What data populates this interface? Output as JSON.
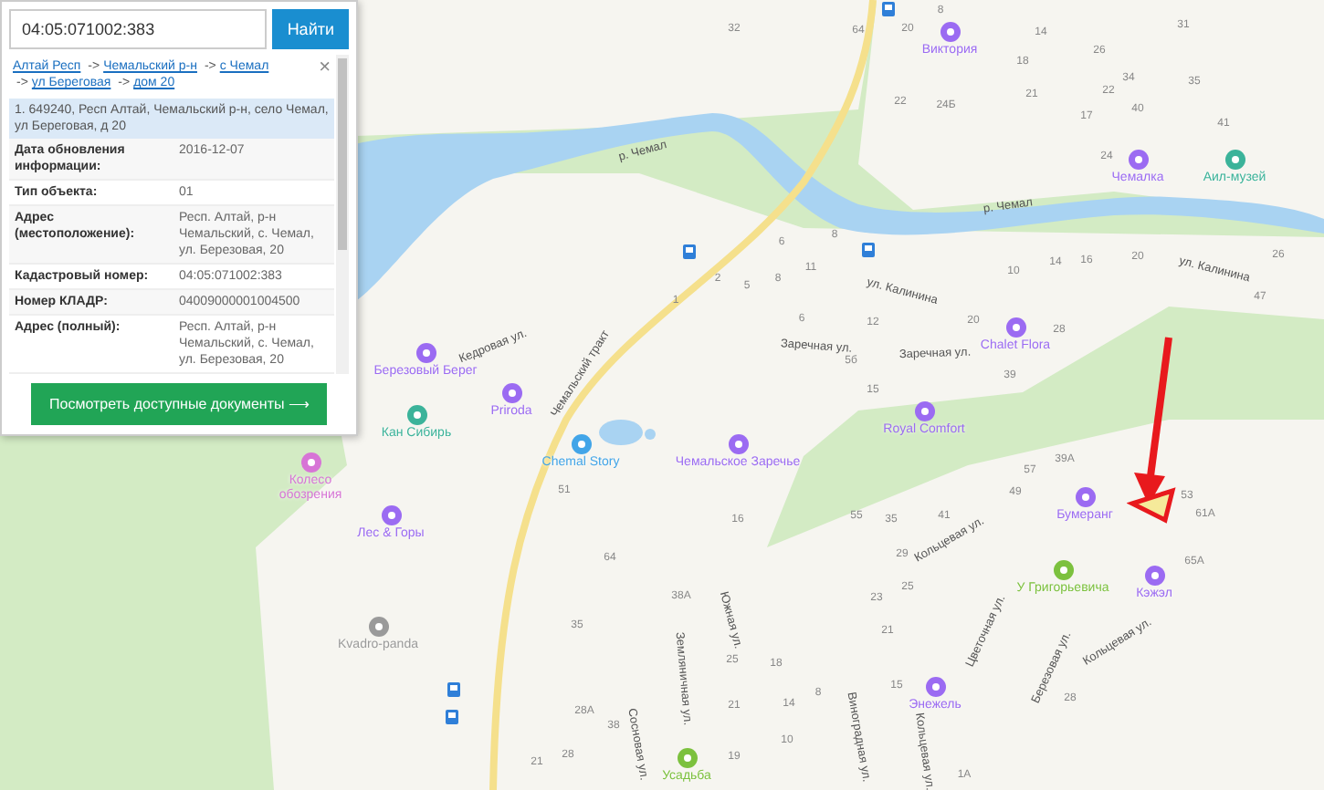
{
  "search": {
    "value": "04:05:071002:383",
    "button": "Найти"
  },
  "panel": {
    "breadcrumb": [
      "Алтай Респ",
      "Чемальский р-н",
      "с Чемал",
      "ул Береговая",
      "дом 20"
    ],
    "separator": "->",
    "close": "×",
    "result": "1. 649240, Респ Алтай, Чемальский р-н, село Чемал, ул Береговая, д 20",
    "rows": [
      {
        "label": "Дата обновления информации:",
        "value": "2016-12-07"
      },
      {
        "label": "Тип объекта:",
        "value": "01"
      },
      {
        "label": "Адрес (местоположение):",
        "value": "Респ. Алтай, р-н Чемальский, с. Чемал, ул. Березовая, 20"
      },
      {
        "label": "Кадастровый номер:",
        "value": "04:05:071002:383"
      },
      {
        "label": "Номер КЛАДР:",
        "value": "04009000001004500"
      },
      {
        "label": "Адрес (полный):",
        "value": "Респ. Алтай, р-н Чемальский, с. Чемал, ул. Березовая, 20"
      }
    ],
    "documents_button": "Посмотреть доступные документы ⟶"
  },
  "map": {
    "places": [
      {
        "name": "Виктория",
        "color": "#9b6bf2"
      },
      {
        "name": "Чемалка",
        "color": "#9b6bf2"
      },
      {
        "name": "Аил-музей",
        "color": "#3bb39a"
      },
      {
        "name": "Березовый Берег",
        "color": "#9b6bf2"
      },
      {
        "name": "Chalet Flora",
        "color": "#9b6bf2"
      },
      {
        "name": "Royal Comfort",
        "color": "#9b6bf2"
      },
      {
        "name": "Priroda",
        "color": "#9b6bf2"
      },
      {
        "name": "Кан Сибирь",
        "color": "#3bb39a"
      },
      {
        "name": "Колесо обозрения",
        "color": "#d775d6"
      },
      {
        "name": "Chemal Story",
        "color": "#42a5e8"
      },
      {
        "name": "Чемальское Заречье",
        "color": "#9b6bf2"
      },
      {
        "name": "Лес & Горы",
        "color": "#9b6bf2"
      },
      {
        "name": "Kvadro-panda",
        "color": "#9a9a9a"
      },
      {
        "name": "Бумеранг",
        "color": "#9b6bf2"
      },
      {
        "name": "У Григорьевича",
        "color": "#7cc13e"
      },
      {
        "name": "Кэжэл",
        "color": "#9b6bf2"
      },
      {
        "name": "Энежель",
        "color": "#9b6bf2"
      },
      {
        "name": "Усадьба",
        "color": "#7cc13e"
      }
    ],
    "streets": [
      "р. Чемал",
      "р. Чемал",
      "Чемальский тракт",
      "Кедровая ул.",
      "ул. Калинина",
      "ул. Калинина",
      "Заречная ул.",
      "Заречная ул.",
      "Южная ул.",
      "Земляничная ул.",
      "Кольцевая ул.",
      "Кольцевая ул.",
      "Кольцевая ул.",
      "Цветочная ул.",
      "Березовая ул.",
      "Виноградная ул.",
      "Сосновая ул."
    ],
    "house_numbers": [
      "32",
      "64",
      "20",
      "8",
      "14",
      "18",
      "26",
      "34",
      "22",
      "40",
      "35",
      "41",
      "31",
      "21",
      "17",
      "24",
      "22",
      "24Б",
      "6",
      "8",
      "11",
      "2",
      "5",
      "8",
      "1",
      "6",
      "12",
      "10",
      "14",
      "16",
      "20",
      "26",
      "47",
      "20",
      "28",
      "5б",
      "15",
      "39",
      "51",
      "64",
      "35",
      "38А",
      "16",
      "55",
      "29",
      "25",
      "23",
      "41",
      "35",
      "49",
      "57",
      "39А",
      "53",
      "61А",
      "65А",
      "21",
      "18",
      "25",
      "8",
      "15",
      "28А",
      "21",
      "14",
      "10",
      "38",
      "28",
      "21",
      "19",
      "28",
      "1А"
    ]
  }
}
